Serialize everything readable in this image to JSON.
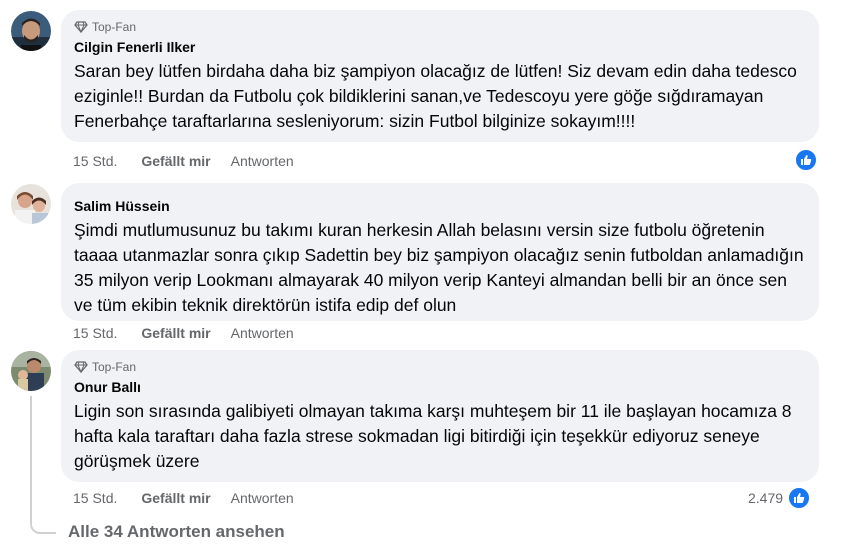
{
  "comments": [
    {
      "badge": "Top-Fan",
      "author": "Cilgin Fenerli Ilker",
      "text": "Saran bey lütfen birdaha daha biz şampiyon olacağız de lütfen! Siz devam edin daha tedesco eziginle!! Burdan da Futbolu çok bildiklerini sanan,ve Tedescoyu yere göğe sığdıramayan Fenerbahçe taraftarlarına sesleniyorum: sizin Futbol bilginize sokayım!!!!",
      "time": "15 Std.",
      "like": "Gefällt mir",
      "reply": "Antworten",
      "reaction_count": ""
    },
    {
      "badge": "",
      "author": "Salim Hüssein",
      "text": "Şimdi mutlumusunuz bu takımı kuran herkesin Allah belasını versin size futbolu öğretenin taaaa utanmazlar sonra çıkıp Sadettin bey biz şampiyon olacağız senin futboldan anlamadığın 35 milyon verip Lookmanı almayarak 40 milyon verip Kanteyi almandan belli bir an önce sen ve tüm ekibin teknik direktörün istifa edip def olun",
      "time": "15 Std.",
      "like": "Gefällt mir",
      "reply": "Antworten",
      "reaction_count": ""
    },
    {
      "badge": "Top-Fan",
      "author": "Onur Ballı",
      "text": "Ligin son sırasında galibiyeti olmayan takıma karşı muhteşem bir 11 ile başlayan hocamıza 8 hafta kala taraftarı daha fazla strese sokmadan ligi bitirdiği için teşekkür ediyoruz seneye görüşmek üzere",
      "time": "15 Std.",
      "like": "Gefällt mir",
      "reply": "Antworten",
      "reaction_count": "2.479"
    }
  ],
  "view_more": "Alle 34 Antworten ansehen",
  "colors": {
    "bubble": "#f0f2f5",
    "secondary_text": "#65676b",
    "like_blue": "#1877f2"
  }
}
